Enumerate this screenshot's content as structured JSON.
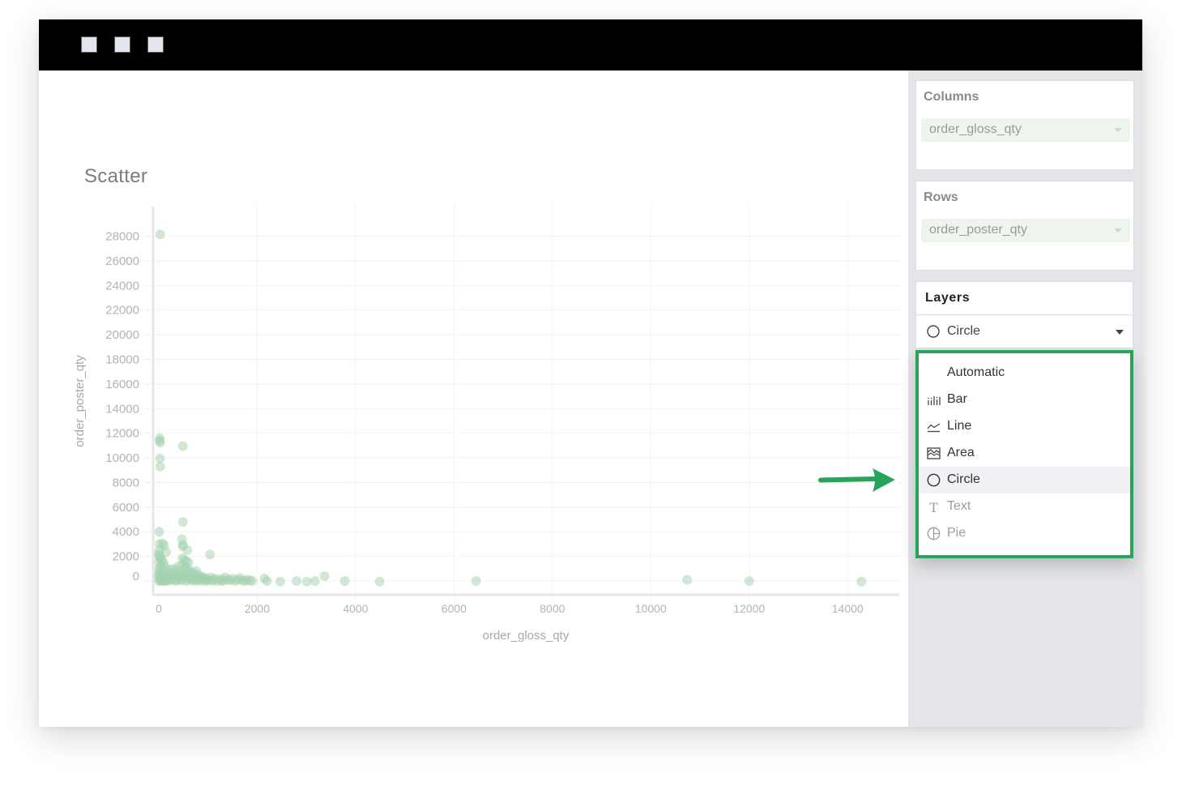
{
  "window": {
    "controls": [
      "window-control",
      "window-control",
      "window-control"
    ]
  },
  "chart_title": "Scatter",
  "sidebar": {
    "columns": {
      "label": "Columns",
      "field": "order_gloss_qty"
    },
    "rows": {
      "label": "Rows",
      "field": "order_poster_qty"
    },
    "layers": {
      "label": "Layers",
      "selected": "Circle",
      "selected_icon": "circle-icon"
    },
    "menu": {
      "highlighted": "Circle",
      "items": [
        {
          "label": "Automatic",
          "icon": "none",
          "disabled": false
        },
        {
          "label": "Bar",
          "icon": "bar-chart-icon",
          "disabled": false
        },
        {
          "label": "Line",
          "icon": "line-chart-icon",
          "disabled": false
        },
        {
          "label": "Area",
          "icon": "area-chart-icon",
          "disabled": false
        },
        {
          "label": "Circle",
          "icon": "circle-icon",
          "disabled": false
        },
        {
          "label": "Text",
          "icon": "text-icon",
          "disabled": true
        },
        {
          "label": "Pie",
          "icon": "pie-chart-icon",
          "disabled": true
        }
      ]
    }
  },
  "annotation": {
    "arrow_color": "#27a35a",
    "highlight_border_color": "#27a35a",
    "points_to": "Circle"
  },
  "colors": {
    "accent": "#27a35a",
    "point_fill": "#a3d1ae",
    "pill_bg": "#eef5ef",
    "sidebar_bg": "#e4e5e9"
  },
  "chart_data": {
    "type": "scatter",
    "title": "Scatter",
    "xlabel": "order_gloss_qty",
    "ylabel": "order_poster_qty",
    "xlim": [
      -115,
      15050
    ],
    "ylim": [
      -1050,
      30400
    ],
    "grid": true,
    "legend": "none",
    "xticks": [
      0,
      2000,
      4000,
      6000,
      8000,
      10000,
      12000,
      14000
    ],
    "xtick_labels": [
      "0",
      "2000",
      "4000",
      "6000",
      "8000",
      "10000",
      "12000",
      "14000"
    ],
    "yticks": [
      0,
      2000,
      4000,
      6000,
      8000,
      10000,
      12000,
      14000,
      16000,
      18000,
      20000,
      22000,
      24000,
      26000,
      28000
    ],
    "ytick_labels": [
      "0",
      "2000",
      "4000",
      "6000",
      "8000",
      "10000",
      "12000",
      "14000",
      "16000",
      "18000",
      "20000",
      "22000",
      "24000",
      "26000",
      "28000"
    ],
    "points": [
      [
        30,
        28150
      ],
      [
        20,
        11600
      ],
      [
        25,
        11250
      ],
      [
        20,
        11400
      ],
      [
        490,
        10950
      ],
      [
        25,
        9950
      ],
      [
        30,
        9300
      ],
      [
        490,
        4800
      ],
      [
        10,
        4000
      ],
      [
        470,
        3400
      ],
      [
        80,
        3050
      ],
      [
        110,
        2900
      ],
      [
        490,
        2950
      ],
      [
        490,
        2800
      ],
      [
        580,
        2500
      ],
      [
        150,
        2350
      ],
      [
        1040,
        2150
      ],
      [
        10,
        2050
      ],
      [
        480,
        1850
      ],
      [
        520,
        1700
      ],
      [
        560,
        1600
      ],
      [
        600,
        1500
      ],
      [
        80,
        1600
      ],
      [
        100,
        1400
      ],
      [
        20,
        1900
      ],
      [
        5,
        500
      ],
      [
        5,
        1000
      ],
      [
        5,
        1500
      ],
      [
        10,
        2500
      ],
      [
        15,
        3000
      ],
      [
        10,
        700
      ],
      [
        30,
        1200
      ],
      [
        50,
        1800
      ],
      [
        0,
        2200
      ],
      [
        0,
        0
      ],
      [
        20,
        100
      ],
      [
        40,
        300
      ],
      [
        60,
        600
      ],
      [
        80,
        900
      ],
      [
        100,
        200
      ],
      [
        120,
        500
      ],
      [
        140,
        1100
      ],
      [
        160,
        300
      ],
      [
        180,
        700
      ],
      [
        200,
        100
      ],
      [
        220,
        400
      ],
      [
        240,
        900
      ],
      [
        260,
        200
      ],
      [
        280,
        600
      ],
      [
        300,
        1000
      ],
      [
        320,
        300
      ],
      [
        340,
        800
      ],
      [
        360,
        100
      ],
      [
        380,
        500
      ],
      [
        400,
        1200
      ],
      [
        420,
        300
      ],
      [
        440,
        700
      ],
      [
        460,
        100
      ],
      [
        480,
        1300
      ],
      [
        500,
        500
      ],
      [
        520,
        900
      ],
      [
        540,
        200
      ],
      [
        560,
        1100
      ],
      [
        580,
        600
      ],
      [
        600,
        300
      ],
      [
        620,
        900
      ],
      [
        640,
        200
      ],
      [
        660,
        700
      ],
      [
        680,
        400
      ],
      [
        700,
        100
      ],
      [
        720,
        600
      ],
      [
        740,
        300
      ],
      [
        760,
        800
      ],
      [
        780,
        200
      ],
      [
        800,
        500
      ],
      [
        820,
        100
      ],
      [
        850,
        400
      ],
      [
        880,
        200
      ],
      [
        910,
        300
      ],
      [
        940,
        100
      ],
      [
        970,
        200
      ],
      [
        1000,
        50
      ],
      [
        1050,
        300
      ],
      [
        1100,
        100
      ],
      [
        1150,
        200
      ],
      [
        1200,
        0
      ],
      [
        1250,
        150
      ],
      [
        1300,
        50
      ],
      [
        1350,
        300
      ],
      [
        1400,
        100
      ],
      [
        1450,
        50
      ],
      [
        1500,
        200
      ],
      [
        1550,
        0
      ],
      [
        1600,
        100
      ],
      [
        1650,
        250
      ],
      [
        1700,
        50
      ],
      [
        1750,
        0
      ],
      [
        1800,
        100
      ],
      [
        1850,
        50
      ],
      [
        1900,
        0
      ],
      [
        50,
        50
      ],
      [
        150,
        0
      ],
      [
        250,
        50
      ],
      [
        350,
        0
      ],
      [
        450,
        50
      ],
      [
        550,
        0
      ],
      [
        650,
        50
      ],
      [
        750,
        0
      ],
      [
        850,
        0
      ],
      [
        950,
        0
      ],
      [
        1100,
        0
      ],
      [
        1300,
        0
      ],
      [
        0,
        400
      ],
      [
        70,
        0
      ],
      [
        130,
        0
      ],
      [
        2150,
        200
      ],
      [
        2200,
        0
      ],
      [
        2470,
        -50
      ],
      [
        2800,
        0
      ],
      [
        3010,
        -50
      ],
      [
        3175,
        0
      ],
      [
        3370,
        400
      ],
      [
        3780,
        0
      ],
      [
        4490,
        -50
      ],
      [
        6450,
        0
      ],
      [
        10740,
        100
      ],
      [
        12000,
        0
      ],
      [
        14280,
        -50
      ]
    ]
  }
}
